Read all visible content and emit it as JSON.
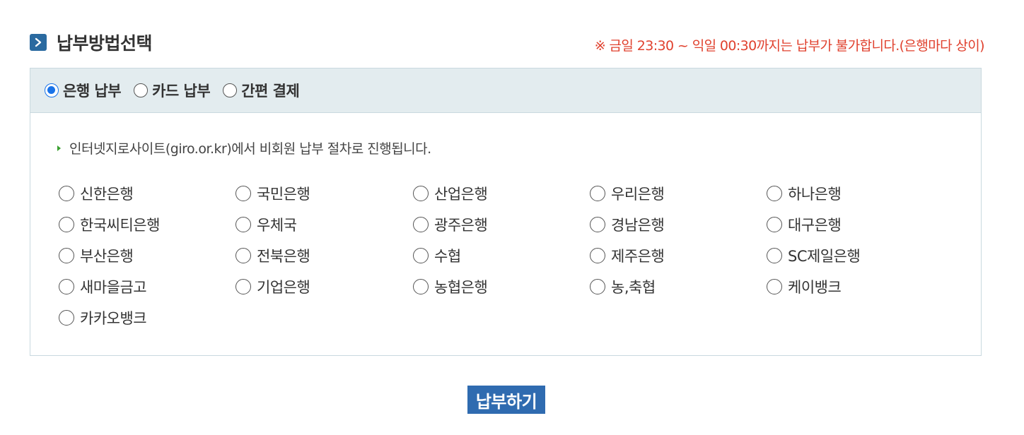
{
  "header": {
    "title": "납부방법선택",
    "notice": "※ 금일 23:30 ~ 익일 00:30까지는 납부가 불가합니다.(은행마다 상이)"
  },
  "payment_tabs": [
    {
      "label": "은행 납부",
      "checked": true
    },
    {
      "label": "카드 납부",
      "checked": false
    },
    {
      "label": "간편 결제",
      "checked": false
    }
  ],
  "guide_text": "인터넷지로사이트(giro.or.kr)에서 비회원 납부 절차로 진행됩니다.",
  "banks": [
    "신한은행",
    "국민은행",
    "산업은행",
    "우리은행",
    "하나은행",
    "한국씨티은행",
    "우체국",
    "광주은행",
    "경남은행",
    "대구은행",
    "부산은행",
    "전북은행",
    "수협",
    "제주은행",
    "SC제일은행",
    "새마을금고",
    "기업은행",
    "농협은행",
    "농,축협",
    "케이뱅크",
    "카카오뱅크"
  ],
  "submit_label": "납부하기",
  "colors": {
    "accent": "#2f6bb0",
    "notice": "#e0412e",
    "tab_bar_bg": "#e3ecef",
    "radio_checked": "#1a73e8"
  }
}
